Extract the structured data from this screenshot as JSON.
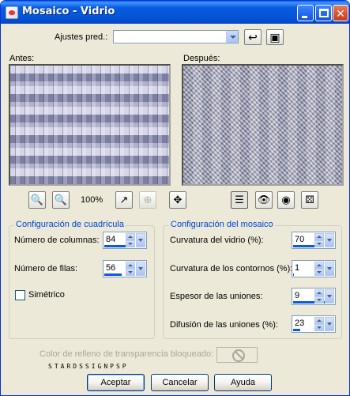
{
  "window": {
    "title": "Mosaico - Vidrio"
  },
  "presets": {
    "label": "Ajustes pred.:",
    "value": ""
  },
  "preview": {
    "before_label": "Antes:",
    "after_label": "Después:",
    "zoom": "100%"
  },
  "grid_group": {
    "title": "Configuración de cuadrícula",
    "columns_label": "Número de columnas:",
    "columns_value": "84",
    "columns_fill": 0.84,
    "rows_label": "Número de filas:",
    "rows_value": "56",
    "rows_fill": 0.56,
    "symmetric_label": "Simétrico",
    "symmetric_checked": false
  },
  "mosaic_group": {
    "title": "Configuración del mosaico",
    "curvature_label": "Curvatura del vidrio (%):",
    "curvature_value": "70",
    "curvature_fill": 0.7,
    "edge_label": "Curvatura de los contornos (%):",
    "edge_value": "1",
    "edge_fill": 0.01,
    "grout_label": "Espesor de las uniones:",
    "grout_value": "9",
    "grout_fill": 1.0,
    "diffuse_label": "Difusión de las uniones (%):",
    "diffuse_value": "23",
    "diffuse_fill": 0.23
  },
  "transparency": {
    "label": "Color de relleno de transparencia bloqueado:"
  },
  "letters": "STARDSSIGNPSP",
  "buttons": {
    "ok": "Aceptar",
    "cancel": "Cancelar",
    "help": "Ayuda"
  },
  "colors": {
    "title_bar": "#0555d8",
    "dialog_bg": "#ece9d8",
    "group_title": "#0046d5",
    "accent": "#0a5ae0"
  }
}
